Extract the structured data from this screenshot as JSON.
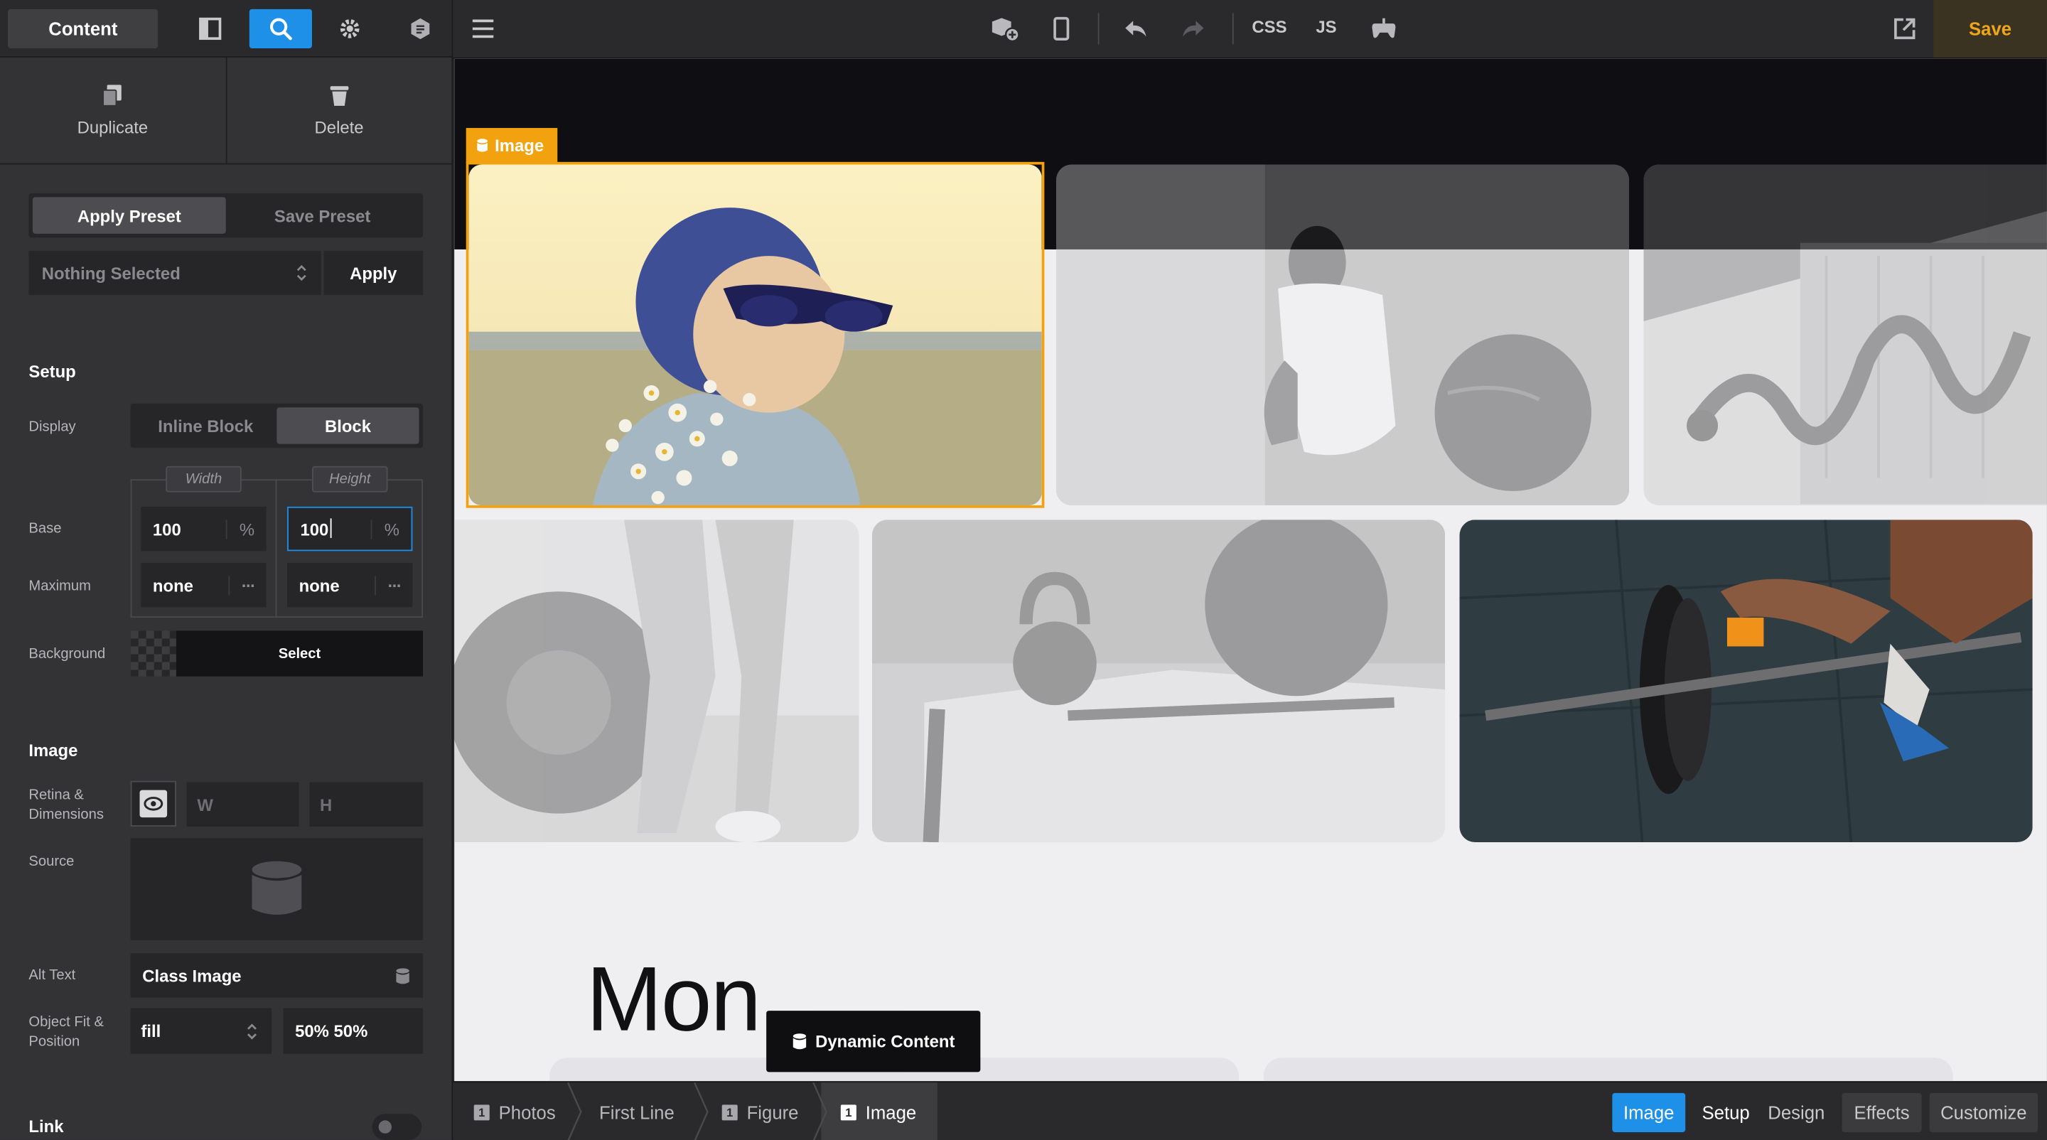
{
  "sidebar": {
    "content_label": "Content",
    "duplicate_label": "Duplicate",
    "delete_label": "Delete",
    "apply_preset_label": "Apply Preset",
    "save_preset_label": "Save Preset",
    "preset_select_value": "Nothing Selected",
    "preset_apply_label": "Apply",
    "setup_title": "Setup",
    "display_label": "Display",
    "display_options": [
      "Inline Block",
      "Block"
    ],
    "width_tag": "Width",
    "height_tag": "Height",
    "base_label": "Base",
    "base_width": "100",
    "base_height": "100",
    "unit_percent": "%",
    "maximum_label": "Maximum",
    "max_width": "none",
    "max_height": "none",
    "more_glyph": "···",
    "background_label": "Background",
    "background_select": "Select",
    "image_title": "Image",
    "retina_label": "Retina &",
    "dimensions_label": "Dimensions",
    "w_placeholder": "W",
    "h_placeholder": "H",
    "source_label": "Source",
    "alt_text_label": "Alt Text",
    "alt_text_value": "Class Image",
    "object_fit_label": "Object Fit &",
    "position_label": "Position",
    "object_fit_value": "fill",
    "position_value": "50% 50%",
    "link_title": "Link"
  },
  "toolbar": {
    "css_label": "CSS",
    "js_label": "JS",
    "save_label": "Save"
  },
  "canvas": {
    "selected_tag": "Image",
    "heading_text": "Mon",
    "dynamic_content_label": "Dynamic Content"
  },
  "bottombar": {
    "crumbs": [
      {
        "num": "1",
        "label": "Photos"
      },
      {
        "num": "",
        "label": "First Line"
      },
      {
        "num": "1",
        "label": "Figure"
      },
      {
        "num": "1",
        "label": "Image"
      }
    ],
    "image_btn": "Image",
    "setup_btn": "Setup",
    "design_btn": "Design",
    "effects_btn": "Effects",
    "customize_btn": "Customize"
  },
  "colors": {
    "accent_blue": "#1e90e8",
    "selection_orange": "#f2a20f",
    "save_gold": "#f0a61a"
  }
}
